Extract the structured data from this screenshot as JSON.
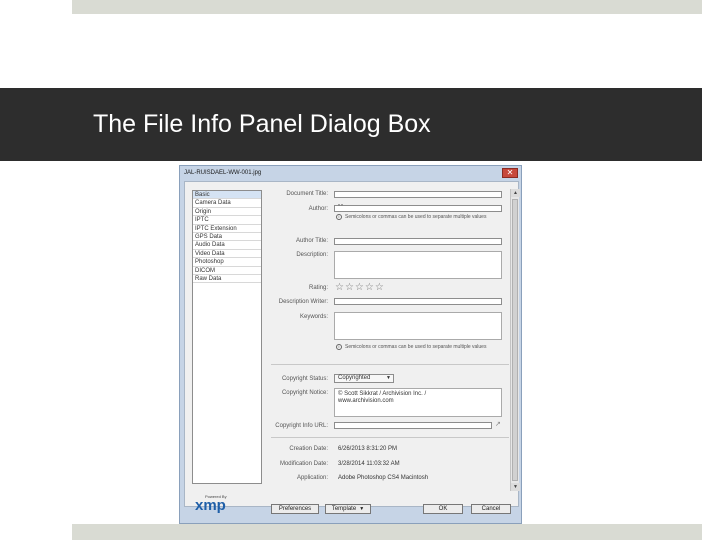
{
  "slide": {
    "title": "The File Info Panel Dialog Box"
  },
  "dialog": {
    "title": "JAL-RUISDAEL-WW-001.jpg",
    "close_icon": "close-icon",
    "sidebar_items": [
      "Basic",
      "Camera Data",
      "Origin",
      "IPTC",
      "IPTC Extension",
      "GPS Data",
      "Audio Data",
      "Video Data",
      "Photoshop",
      "DICOM",
      "Raw Data"
    ],
    "xmp": {
      "powered_by": "Powered By",
      "logo": "xmp"
    },
    "labels": {
      "document_title": "Document Title:",
      "author": "Author:",
      "author_title": "Author Title:",
      "description": "Description:",
      "rating": "Rating:",
      "description_writer": "Description Writer:",
      "keywords": "Keywords:",
      "copyright_status": "Copyright Status:",
      "copyright_notice": "Copyright Notice:",
      "copyright_info_url": "Copyright Info URL:",
      "creation_date": "Creation Date:",
      "modification_date": "Modification Date:",
      "application": "Application:"
    },
    "values": {
      "author": "\"         \"",
      "author_hint": "Semicolons or commas can be used to separate multiple values",
      "keywords_hint": "Semicolons or commas can be used to separate multiple values",
      "copyright_status": "Copyrighted",
      "copyright_notice": "© Scott Sikkrat / Archivision Inc. / www.archivision.com",
      "creation_date": "6/26/2013 8:31:20 PM",
      "modification_date": "3/28/2014 11:03:32 AM",
      "application": "Adobe Photoshop CS4 Macintosh"
    },
    "rating_stars": "☆☆☆☆☆",
    "buttons": {
      "preferences": "Preferences",
      "template": "Template",
      "ok": "OK",
      "cancel": "Cancel"
    }
  }
}
